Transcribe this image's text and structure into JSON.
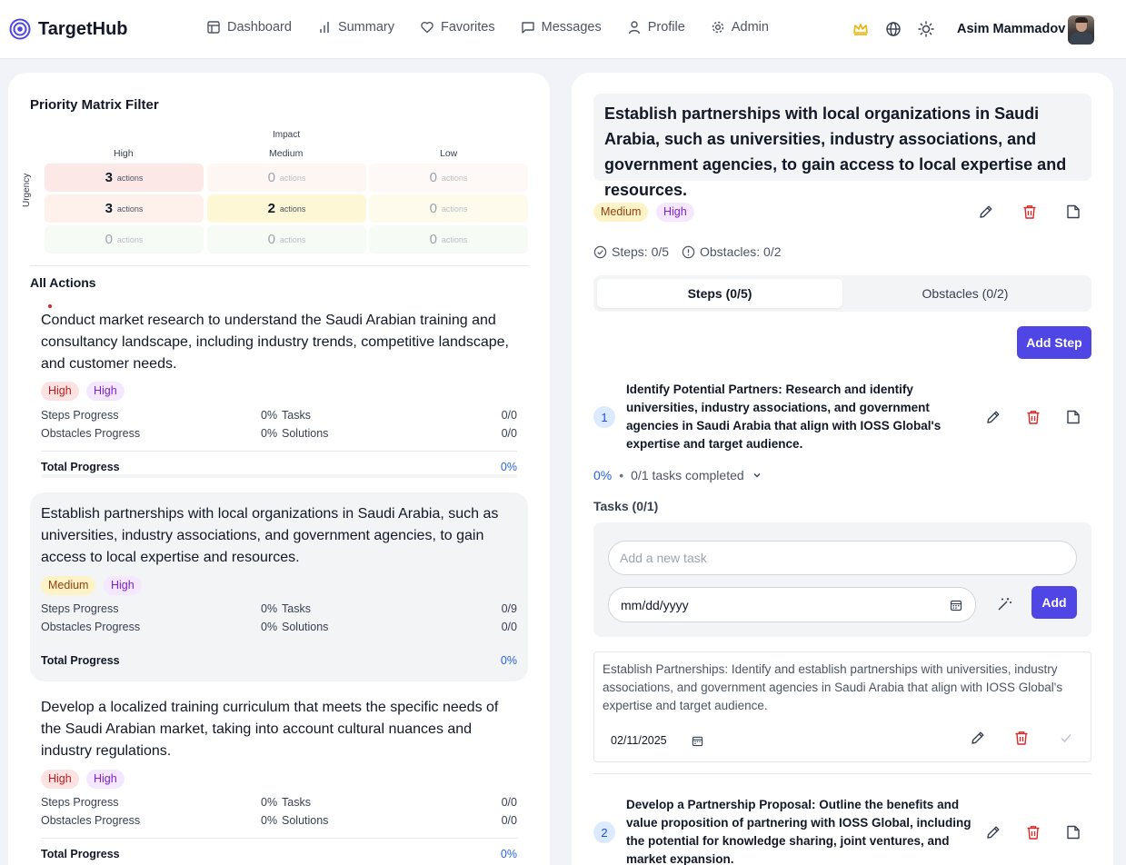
{
  "app": {
    "name": "TargetHub"
  },
  "nav": {
    "items": [
      {
        "label": "Dashboard",
        "icon": "dashboard-icon"
      },
      {
        "label": "Summary",
        "icon": "bar-chart-icon"
      },
      {
        "label": "Favorites",
        "icon": "heart-icon"
      },
      {
        "label": "Messages",
        "icon": "message-icon"
      },
      {
        "label": "Profile",
        "icon": "user-icon"
      },
      {
        "label": "Admin",
        "icon": "gear-icon"
      }
    ]
  },
  "user": {
    "name": "Asim Mammadov"
  },
  "matrix": {
    "title": "Priority Matrix Filter",
    "impact_label": "Impact",
    "urgency_label": "Urgency",
    "columns": [
      "High",
      "Medium",
      "Low"
    ],
    "unit": "actions",
    "rows": [
      [
        3,
        0,
        0
      ],
      [
        3,
        2,
        0
      ],
      [
        0,
        0,
        0
      ]
    ]
  },
  "actions": {
    "heading": "All Actions",
    "stat_labels": {
      "steps": "Steps Progress",
      "obstacles": "Obstacles Progress",
      "tasks": "Tasks",
      "solutions": "Solutions",
      "total": "Total Progress"
    },
    "items": [
      {
        "title": "Conduct market research to understand the Saudi Arabian training and consultancy landscape, including industry trends, competitive landscape, and customer needs.",
        "badges": [
          "High",
          "High"
        ],
        "steps_pct": "0%",
        "tasks": "0/0",
        "obstacles_pct": "0%",
        "solutions": "0/0",
        "total": "0%"
      },
      {
        "title": "Establish partnerships with local organizations in Saudi Arabia, such as universities, industry associations, and government agencies, to gain access to local expertise and resources.",
        "badges": [
          "Medium",
          "High"
        ],
        "steps_pct": "0%",
        "tasks": "0/9",
        "obstacles_pct": "0%",
        "solutions": "0/0",
        "total": "0%"
      },
      {
        "title": "Develop a localized training curriculum that meets the specific needs of the Saudi Arabian market, taking into account cultural nuances and industry regulations.",
        "badges": [
          "High",
          "High"
        ],
        "steps_pct": "0%",
        "tasks": "0/0",
        "obstacles_pct": "0%",
        "solutions": "0/0",
        "total": "0%"
      }
    ]
  },
  "detail": {
    "title": "Establish partnerships with local organizations in Saudi Arabia, such as universities, industry associations, and government agencies, to gain access to local expertise and resources.",
    "badges": [
      "Medium",
      "High"
    ],
    "steps_meta": "Steps: 0/5",
    "obstacles_meta": "Obstacles: 0/2",
    "tabs": {
      "steps": "Steps (0/5)",
      "obstacles": "Obstacles (0/2)"
    },
    "add_step": "Add Step",
    "steps": [
      {
        "num": "1",
        "title": "Identify Potential Partners: Research and identify universities, industry associations, and government agencies in Saudi Arabia that align with IOSS Global's expertise and target audience.",
        "pct": "0%",
        "tasks_completed": "0/1 tasks completed"
      },
      {
        "num": "2",
        "title": "Develop a Partnership Proposal: Outline the benefits and value proposition of partnering with IOSS Global, including the potential for knowledge sharing, joint ventures, and market expansion."
      }
    ],
    "tasks_heading": "Tasks (0/1)",
    "task_input_placeholder": "Add a new task",
    "date_placeholder": "mm/dd/yyyy",
    "add_label": "Add",
    "task": {
      "text": "Establish Partnerships: Identify and establish partnerships with universities, industry associations, and government agencies in Saudi Arabia that align with IOSS Global's expertise and target audience.",
      "date": "02/11/2025"
    }
  },
  "colors": {
    "accent": "#4f46e5",
    "link": "#2563eb",
    "danger": "#dc2626",
    "crown": "#eab308"
  }
}
